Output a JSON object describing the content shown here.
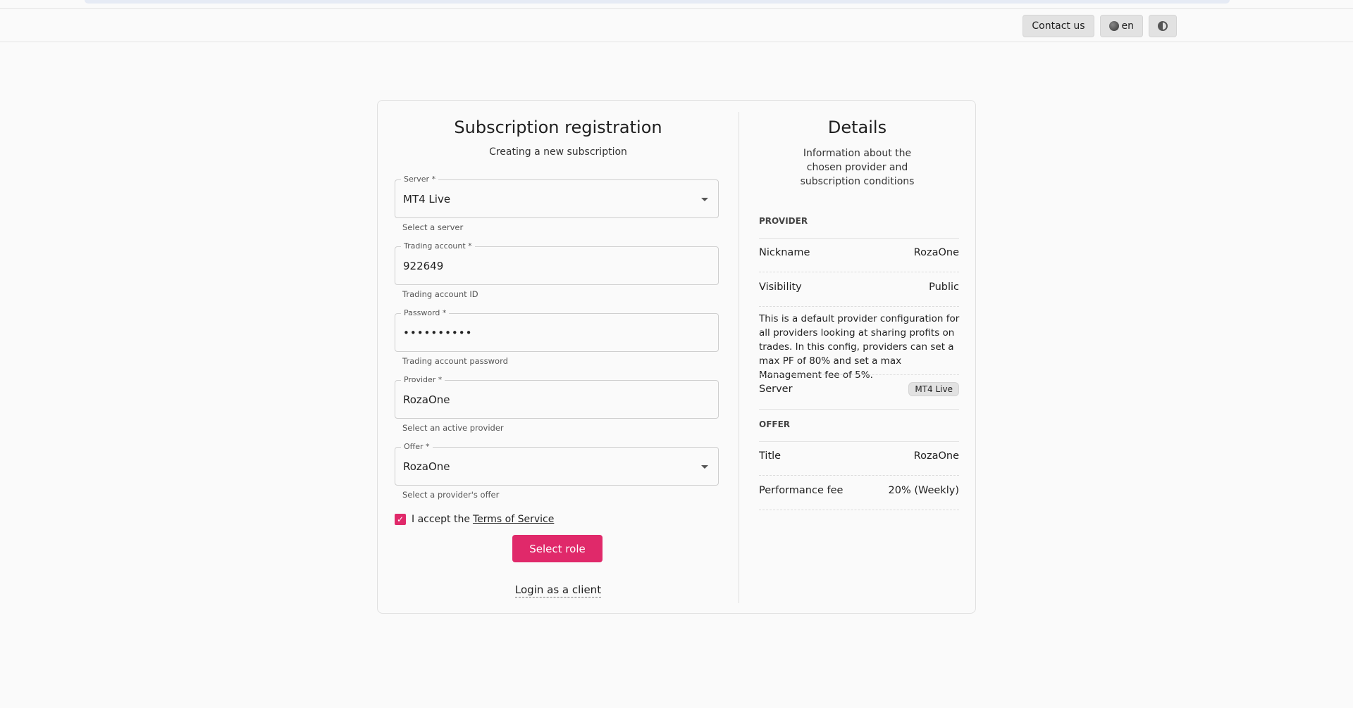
{
  "topbar": {
    "contact_label": "Contact us",
    "language_label": "en",
    "globe_icon": "globe-icon",
    "theme_icon": "contrast-icon"
  },
  "form": {
    "title": "Subscription registration",
    "subtitle": "Creating a new subscription",
    "fields": [
      {
        "label": "Server *",
        "value": "MT4 Live",
        "help": "Select a server",
        "type": "select"
      },
      {
        "label": "Trading account *",
        "value": "922649",
        "help": "Trading account ID",
        "type": "text"
      },
      {
        "label": "Password *",
        "value": "••••••••••",
        "help": "Trading account password",
        "type": "password"
      },
      {
        "label": "Provider *",
        "value": "RozaOne",
        "help": "Select an active provider",
        "type": "text"
      },
      {
        "label": "Offer *",
        "value": "RozaOne",
        "help": "Select a provider's offer",
        "type": "select"
      }
    ],
    "terms_prefix": "I accept the",
    "terms_link": "Terms of Service",
    "terms_checked": true,
    "submit_label": "Select role",
    "login_link": "Login as a client"
  },
  "details": {
    "title": "Details",
    "subtitle": "Information about the chosen provider and subscription conditions",
    "provider_section": "PROVIDER",
    "provider_rows": [
      {
        "key": "Nickname",
        "value": "RozaOne"
      },
      {
        "key": "Visibility",
        "value": "Public"
      }
    ],
    "provider_description": "This is a default provider configuration for all providers looking at sharing profits on trades. In this config, providers can set a max PF of 80% and set a max Management fee of 5%.",
    "server_key": "Server",
    "server_value": "MT4 Live",
    "offer_section": "OFFER",
    "offer_rows": [
      {
        "key": "Title",
        "value": "RozaOne"
      },
      {
        "key": "Performance fee",
        "value": "20% (Weekly)"
      }
    ]
  },
  "colors": {
    "accent": "#e0296a"
  }
}
